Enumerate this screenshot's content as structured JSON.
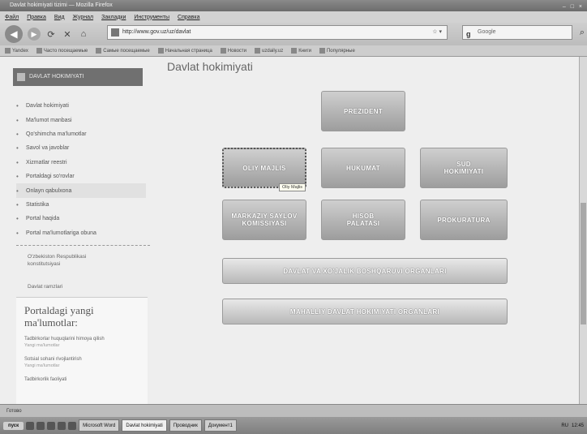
{
  "window": {
    "title": "Davlat hokimiyati tizimi — Mozilla Firefox",
    "controls": [
      "–",
      "□",
      "×"
    ]
  },
  "menu": [
    "Файл",
    "Правка",
    "Вид",
    "Журнал",
    "Закладки",
    "Инструменты",
    "Справка"
  ],
  "nav": {
    "url": "http://www.gov.uz/uz/davlat",
    "search_placeholder": "Google"
  },
  "bookmarks": [
    "Yandex",
    "Часто посещаемые",
    "Самые посещаемые",
    "Начальная страница",
    "Новости",
    "uzdaily.uz",
    "Книги",
    "Популярные"
  ],
  "page": {
    "heading": "Davlat hokimiyati",
    "sidebar_title": "DAVLAT HOKIMIYATI"
  },
  "sidebar": {
    "items": [
      "Davlat hokimiyati",
      "Ma'lumot manbasi",
      "Qo'shimcha ma'lumotlar",
      "Savol va javoblar",
      "Xizmatlar reestri",
      "Portaldagi so'rovlar",
      "Onlayn qabulxona",
      "Statistika",
      "Portal haqida",
      "Portal ma'lumotlariga obuna"
    ],
    "extra_link": "O'zbekiston Respublikasi konstitutsiyasi",
    "emblem_link": "Davlat ramzlari"
  },
  "news": {
    "title": "Portaldagi yangi ma'lumotlar:",
    "items": [
      {
        "text": "Tadbirkorlar huquqlarini himoya qilish",
        "sub": "Yangi ma'lumotlar"
      },
      {
        "text": "Sotsial sohani rivojlantirish",
        "sub": "Yangi ma'lumotlar"
      },
      {
        "text": "Tadbirkorlik faoliyati",
        "sub": ""
      }
    ]
  },
  "org_chart": {
    "president": "PREZIDENT",
    "oliy_majlis": "OLIY MAJLIS",
    "hukumat": "HUKUMAT",
    "sud": "SUD HOKIMIYATI",
    "saylov": "MARKAZIY SAYLOV KOMISSIYASI",
    "hisob": "HISOB PALATASI",
    "prokuratura": "PROKURATURA",
    "xojalik": "DAVLAT VA XO'JALIK BOSHQARUVI ORGANLARI",
    "mahalliy": "MAHALLIY DAVLAT HOKIMIYATI ORGANLARI",
    "tooltip": "Oliy Majlis"
  },
  "status": {
    "text": "Готово"
  },
  "taskbar": {
    "start": "пуск",
    "tasks": [
      "Microsoft Word",
      "Davlat hokimiyati",
      "Проводник",
      "Документ1"
    ],
    "lang": "RU",
    "time": "12:45"
  }
}
